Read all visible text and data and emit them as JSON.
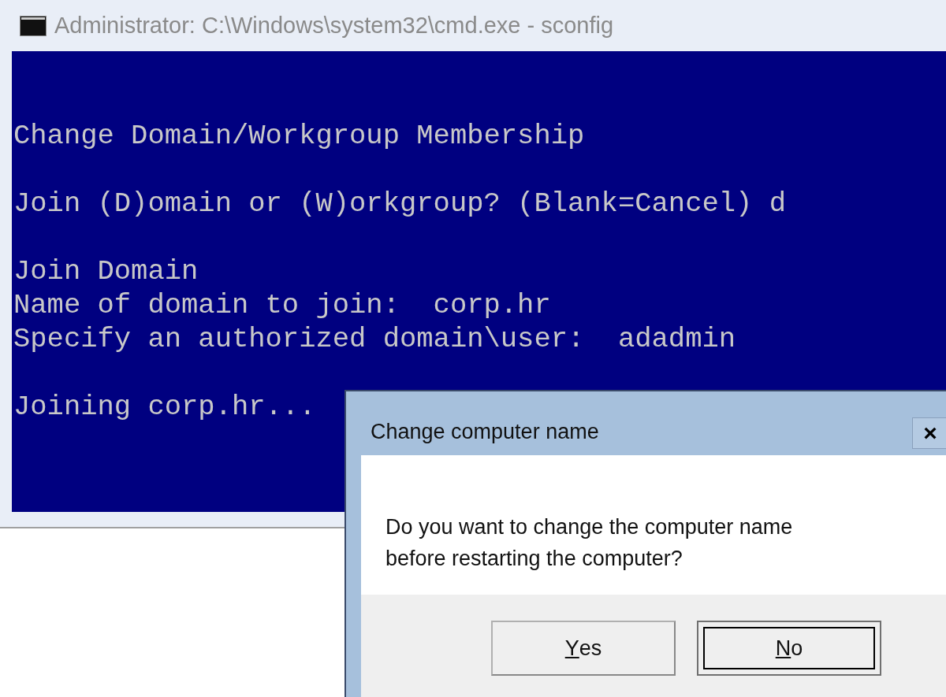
{
  "console_window": {
    "title": "Administrator: C:\\Windows\\system32\\cmd.exe - sconfig",
    "paragraphs": [
      [
        "Change Domain/Workgroup Membership"
      ],
      [
        "Join (D)omain or (W)orkgroup? (Blank=Cancel) d"
      ],
      [
        "Join Domain",
        "Name of domain to join:  corp.hr",
        "Specify an authorized domain\\user:  adadmin"
      ],
      [
        "Joining corp.hr..."
      ]
    ]
  },
  "dialog": {
    "title": "Change computer name",
    "close": "×",
    "message": [
      "Do you want to change the computer name",
      "before restarting the computer?"
    ],
    "buttons": [
      {
        "accelerator": "Y",
        "label_rest": "es",
        "focused": false
      },
      {
        "accelerator": "N",
        "label_rest": "o",
        "focused": true
      }
    ]
  }
}
